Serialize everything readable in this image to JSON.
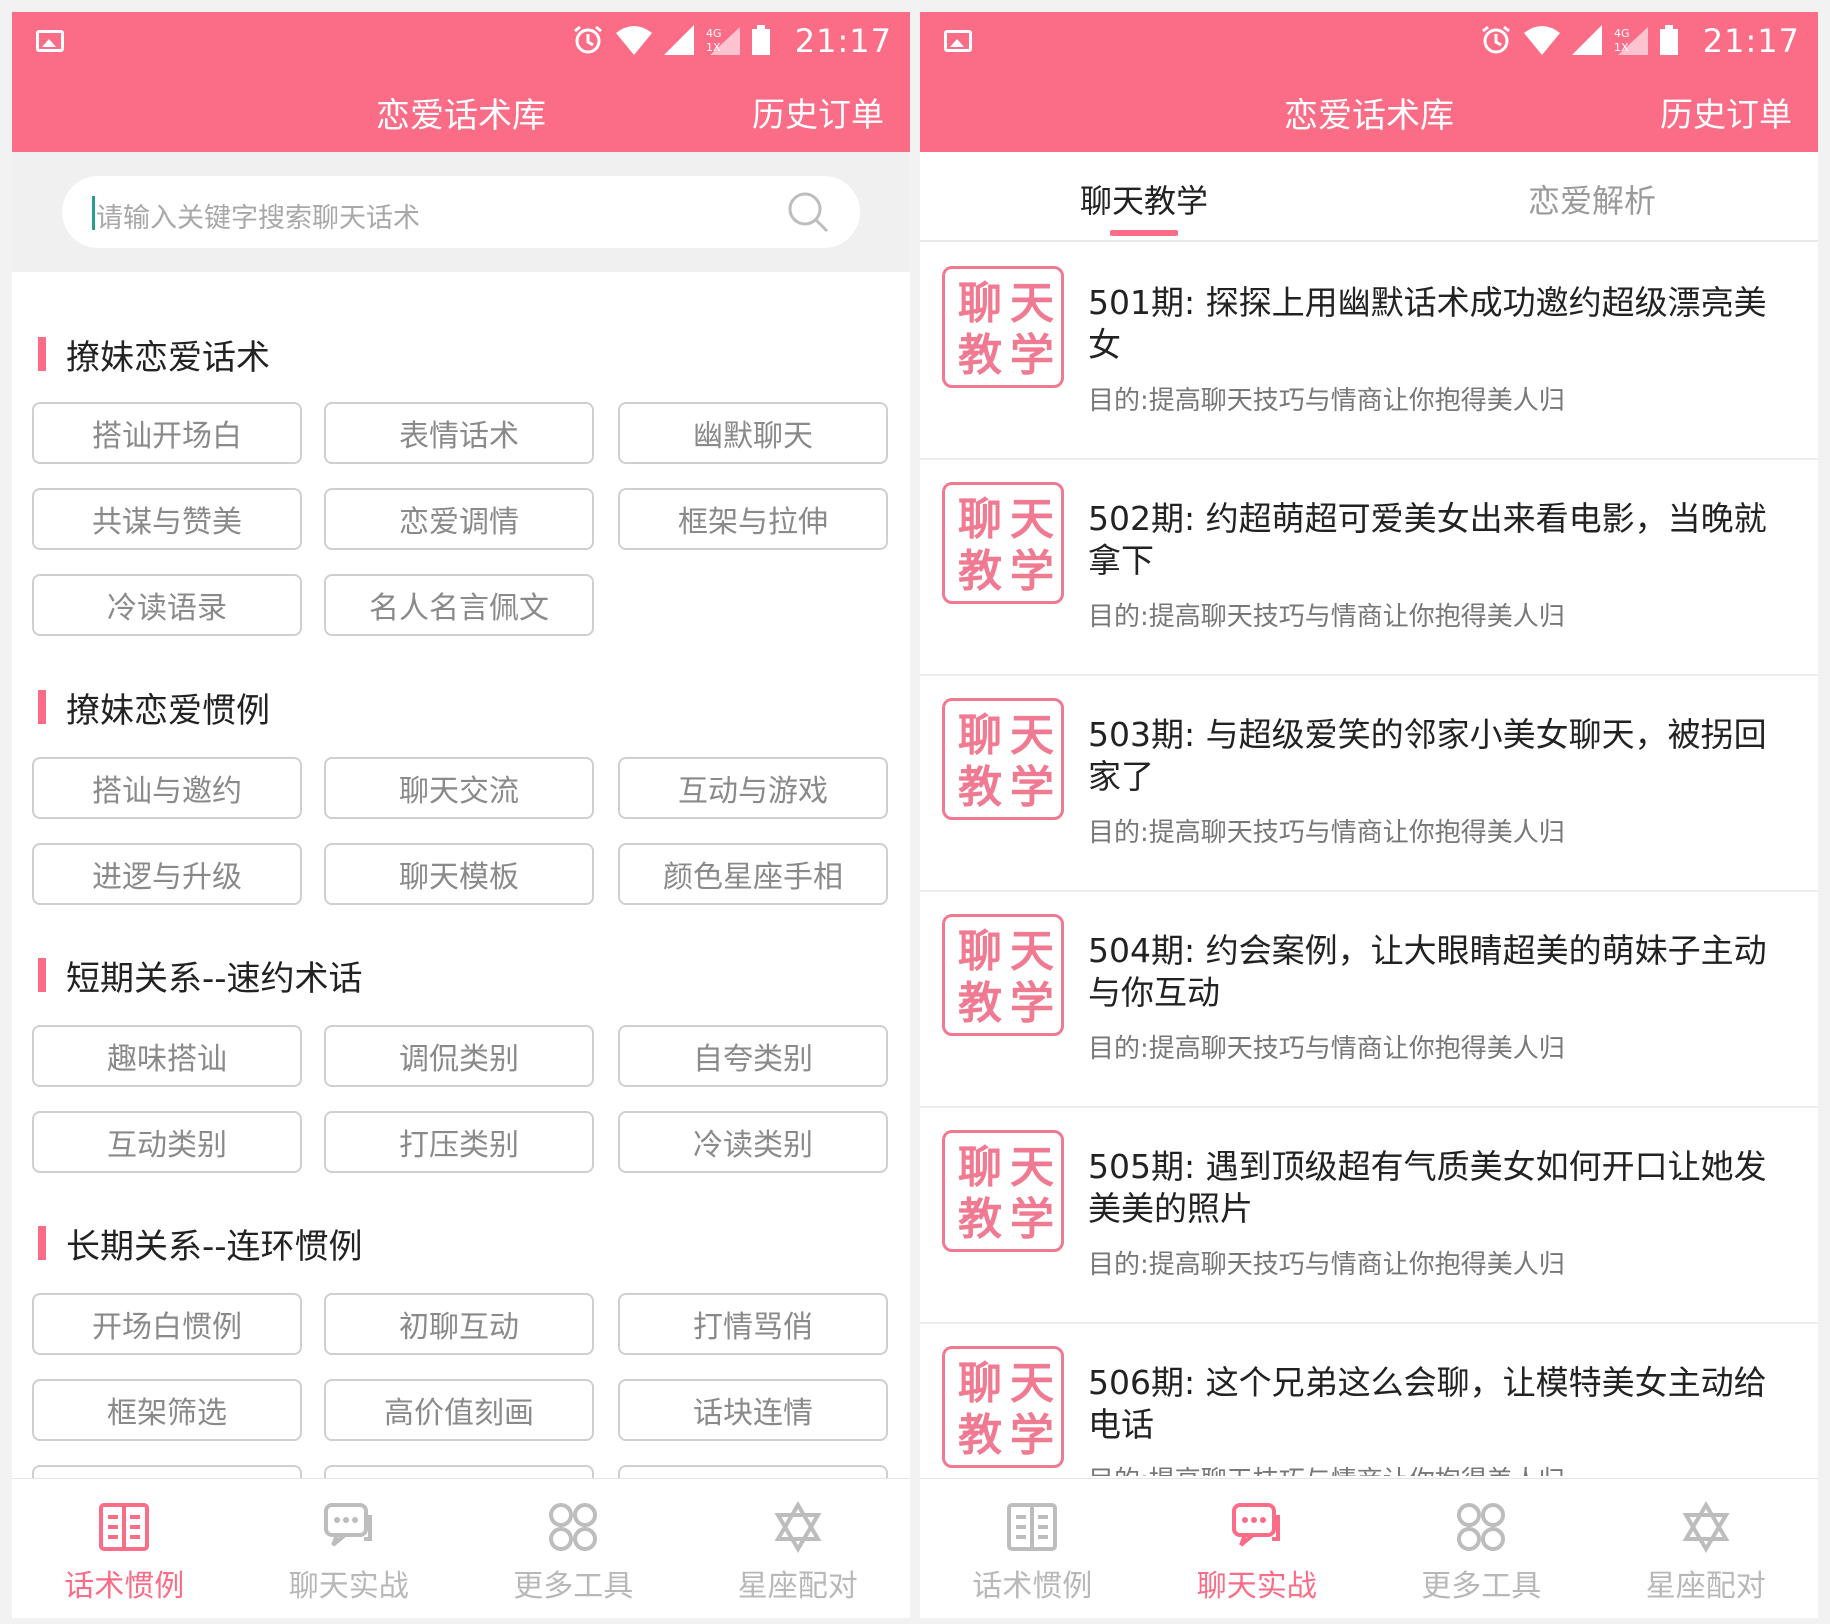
{
  "status": {
    "time": "21:17"
  },
  "left": {
    "nav": {
      "title": "恋爱话术库",
      "right": "历史订单"
    },
    "search": {
      "placeholder": "请输入关键字搜索聊天话术"
    },
    "sections": [
      {
        "title": "撩妹恋爱话术",
        "tags": [
          "搭讪开场白",
          "表情话术",
          "幽默聊天",
          "共谋与赞美",
          "恋爱调情",
          "框架与拉伸",
          "冷读语录",
          "名人名言佩文"
        ]
      },
      {
        "title": "撩妹恋爱惯例",
        "tags": [
          "搭讪与邀约",
          "聊天交流",
          "互动与游戏",
          "进逻与升级",
          "聊天模板",
          "颜色星座手相"
        ]
      },
      {
        "title": "短期关系--速约术话",
        "tags": [
          "趣味搭讪",
          "调侃类别",
          "自夸类别",
          "互动类别",
          "打压类别",
          "冷读类别"
        ]
      },
      {
        "title": "长期关系--连环惯例",
        "tags": [
          "开场白惯例",
          "初聊互动",
          "打情骂俏",
          "框架筛选",
          "高价值刻画",
          "话块连情"
        ]
      }
    ],
    "tabbar": [
      {
        "label": "话术惯例",
        "icon": "book-icon",
        "active": true
      },
      {
        "label": "聊天实战",
        "icon": "chat-icon",
        "active": false
      },
      {
        "label": "更多工具",
        "icon": "grid-icon",
        "active": false
      },
      {
        "label": "星座配对",
        "icon": "star-icon",
        "active": false
      }
    ]
  },
  "right": {
    "nav": {
      "title": "恋爱话术库",
      "right": "历史订单"
    },
    "subtabs": [
      "聊天教学",
      "恋爱解析"
    ],
    "stamp": [
      "聊",
      "天",
      "教",
      "学"
    ],
    "items": [
      {
        "title": "501期: 探探上用幽默话术成功邀约超级漂亮美女",
        "desc": "目的:提高聊天技巧与情商让你抱得美人归"
      },
      {
        "title": "502期:  约超萌超可爱美女出来看电影，当晚就拿下",
        "desc": "目的:提高聊天技巧与情商让你抱得美人归"
      },
      {
        "title": "503期:  与超级爱笑的邻家小美女聊天，被拐回家了",
        "desc": "目的:提高聊天技巧与情商让你抱得美人归"
      },
      {
        "title": "504期:  约会案例，让大眼睛超美的萌妹子主动与你互动",
        "desc": "目的:提高聊天技巧与情商让你抱得美人归"
      },
      {
        "title": "505期:   遇到顶级超有气质美女如何开口让她发美美的照片",
        "desc": "目的:提高聊天技巧与情商让你抱得美人归"
      },
      {
        "title": "506期:   这个兄弟这么会聊，让模特美女主动给电话",
        "desc": "目的:提高聊天技巧与情商让你抱得美人归"
      }
    ],
    "tabbar": [
      {
        "label": "话术惯例",
        "icon": "book-icon",
        "active": false
      },
      {
        "label": "聊天实战",
        "icon": "chat-icon",
        "active": true
      },
      {
        "label": "更多工具",
        "icon": "grid-icon",
        "active": false
      },
      {
        "label": "星座配对",
        "icon": "star-icon",
        "active": false
      }
    ]
  },
  "colors": {
    "accent": "#fb6c87",
    "inactive": "#b8b8b8"
  }
}
